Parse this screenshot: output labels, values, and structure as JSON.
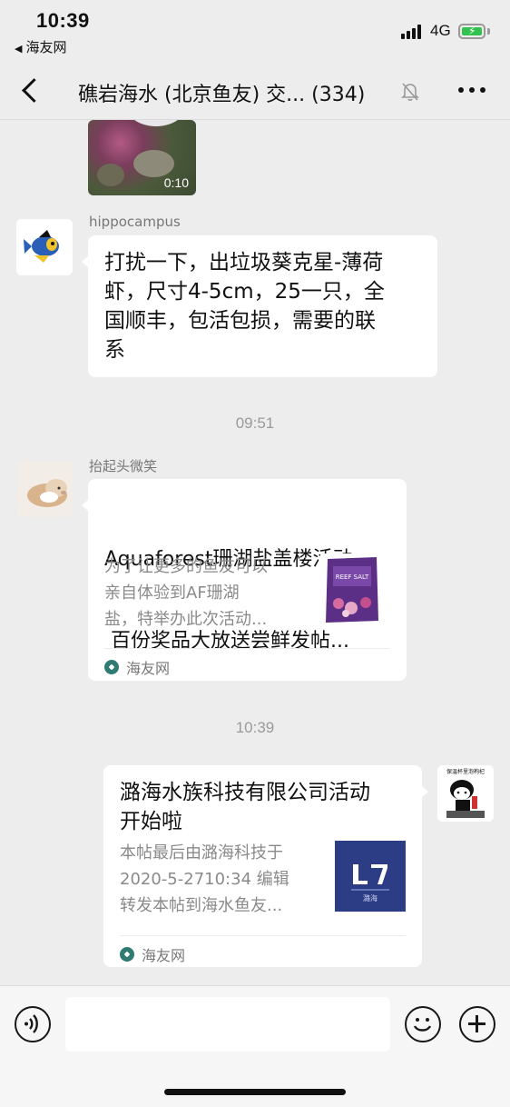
{
  "status_bar": {
    "time": "10:39",
    "back_app": "海友网",
    "network": "4G",
    "battery_color": "#33c24d"
  },
  "nav": {
    "title": "礁岩海水 (北京鱼友) 交... (334)",
    "back_icon": "chevron-left-icon",
    "mute_icon": "bell-off-icon",
    "more_icon": "ellipsis-icon"
  },
  "messages": {
    "video": {
      "duration": "0:10"
    },
    "hippocampus": {
      "sender": "hippocampus",
      "lines": [
        "打扰一下，出垃圾葵克星-薄荷",
        "虾，尺寸4-5cm，25一只，全",
        "国顺丰，包活包损，需要的联",
        "系"
      ]
    },
    "time_0951": "09:51",
    "aquaforest": {
      "sender": "抬起头微笑",
      "title_lines": [
        "Aquaforest珊湖盐盖楼活动",
        " 百份奖品大放送尝鲜发帖..."
      ],
      "desc_lines": [
        "为了让更多的鱼友可以",
        "亲自体验到AF珊湖",
        "盐，特举办此次活动..."
      ],
      "thumb_label": "REEF SALT",
      "source": "海友网"
    },
    "time_1039": "10:39",
    "self_link": {
      "sticker_text": "保温杯里泡枸杞",
      "title_lines": [
        "潞海水族科技有限公司活动",
        "开始啦"
      ],
      "desc_lines": [
        "本帖最后由潞海科技于",
        "2020-5-2710:34 编辑",
        "转发本帖到海水鱼友..."
      ],
      "thumb_caption": "潞海",
      "source": "海友网"
    }
  },
  "input_bar": {
    "voice_icon": "voice-icon",
    "emoji_icon": "emoji-icon",
    "plus_icon": "plus-icon",
    "placeholder": ""
  }
}
